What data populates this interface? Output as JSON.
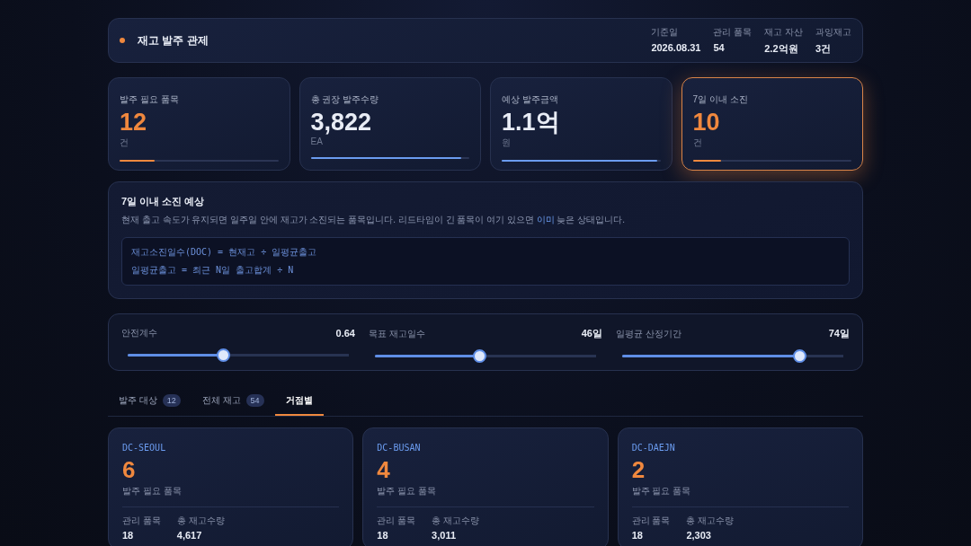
{
  "header": {
    "title": "재고 발주 관제",
    "meta": [
      {
        "label": "기준일",
        "value": "2026.08.31"
      },
      {
        "label": "관리 품목",
        "value": "54"
      },
      {
        "label": "재고 자산",
        "value": "2.2억원"
      },
      {
        "label": "과잉재고",
        "value": "3건"
      }
    ]
  },
  "stats": [
    {
      "label": "발주 필요 품목",
      "value": "12",
      "unit": "건",
      "level": 0.22,
      "color": "#f0883e",
      "highlighted": false
    },
    {
      "label": "총 권장 발주수량",
      "value": "3,822",
      "unit": "EA",
      "level": 0.95,
      "color": "#6b9cf0",
      "highlighted": false
    },
    {
      "label": "예상 발주금액",
      "value": "1.1억",
      "unit": "원",
      "level": 0.98,
      "color": "#6b9cf0",
      "highlighted": false
    },
    {
      "label": "7일 이내 소진",
      "value": "10",
      "unit": "건",
      "level": 0.18,
      "color": "#f0883e",
      "highlighted": true
    }
  ],
  "note": {
    "title": "7일 이내 소진 예상",
    "text": "현재 출고 속도가 유지되면 일주일 안에 재고가 소진되는 품목입니다. 리드타임이 긴 품목이 여기 있으면 **이미** 늦은 상태입니다.",
    "formulas": [
      "재고소진일수(DOC) = 현재고 ÷ 일평균출고",
      "일평균출고 = 최근 N일 출고합계 ÷ N"
    ]
  },
  "sliders": [
    {
      "label": "안전계수",
      "reading": "0.64",
      "level": 0.43
    },
    {
      "label": "목표 재고일수",
      "reading": "46일",
      "level": 0.47
    },
    {
      "label": "일평균 산정기간",
      "reading": "74일",
      "level": 0.8
    }
  ],
  "tabs": [
    {
      "label": "발주 대상",
      "count": "12",
      "selected": false
    },
    {
      "label": "전체 재고",
      "count": "54",
      "selected": false
    },
    {
      "label": "거점별",
      "selected": true
    }
  ],
  "sites": [
    {
      "code": "DC-SEOUL",
      "value": "6",
      "caption": "발주 필요 품목",
      "stats": [
        {
          "label": "관리 품목",
          "value": "18"
        },
        {
          "label": "총 재고수량",
          "value": "4,617"
        }
      ]
    },
    {
      "code": "DC-BUSAN",
      "value": "4",
      "caption": "발주 필요 품목",
      "stats": [
        {
          "label": "관리 품목",
          "value": "18"
        },
        {
          "label": "총 재고수량",
          "value": "3,011"
        }
      ]
    },
    {
      "code": "DC-DAEJN",
      "value": "2",
      "caption": "발주 필요 품목",
      "stats": [
        {
          "label": "관리 품목",
          "value": "18"
        },
        {
          "label": "총 재고수량",
          "value": "2,303"
        }
      ]
    }
  ]
}
